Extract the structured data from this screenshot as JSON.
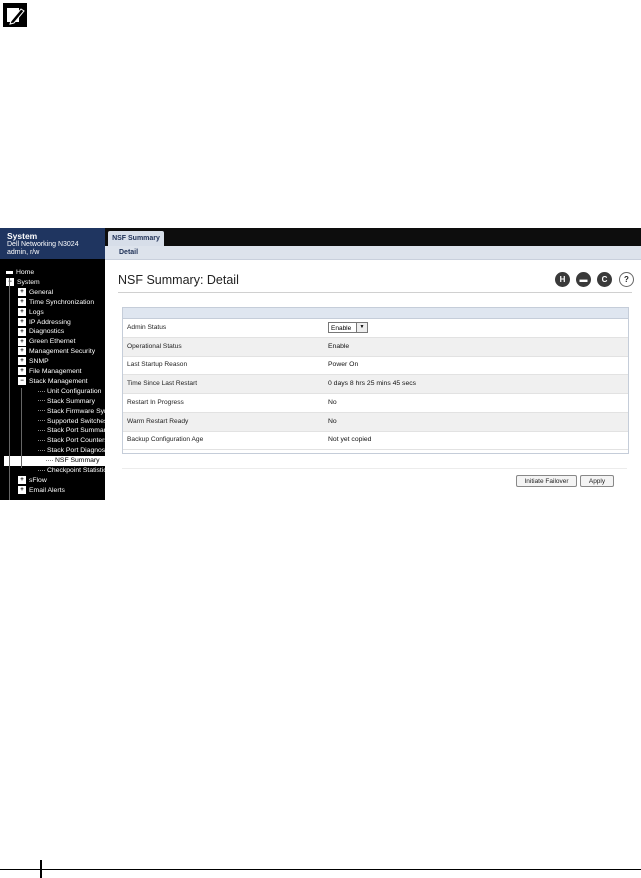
{
  "note_icon": "pencil-note-icon",
  "sidebar": {
    "title": "System",
    "device": "Dell Networking N3024",
    "user": "admin, r/w",
    "tree": [
      {
        "label": "Home",
        "level": 0,
        "box": "",
        "row": 0
      },
      {
        "label": "System",
        "level": 0,
        "box": "−",
        "row": 1
      },
      {
        "label": "General",
        "level": 1,
        "box": "+",
        "row": 2
      },
      {
        "label": "Time Synchronization",
        "level": 1,
        "box": "+",
        "row": 3
      },
      {
        "label": "Logs",
        "level": 1,
        "box": "+",
        "row": 4
      },
      {
        "label": "IP Addressing",
        "level": 1,
        "box": "+",
        "row": 5
      },
      {
        "label": "Diagnostics",
        "level": 1,
        "box": "+",
        "row": 6
      },
      {
        "label": "Green Ethernet",
        "level": 1,
        "box": "+",
        "row": 7
      },
      {
        "label": "Management Security",
        "level": 1,
        "box": "+",
        "row": 8
      },
      {
        "label": "SNMP",
        "level": 1,
        "box": "+",
        "row": 9
      },
      {
        "label": "File Management",
        "level": 1,
        "box": "+",
        "row": 10
      },
      {
        "label": "Stack Management",
        "level": 1,
        "box": "−",
        "row": 11
      },
      {
        "label": "Unit Configuration",
        "level": 2,
        "box": "",
        "row": 12
      },
      {
        "label": "Stack Summary",
        "level": 2,
        "box": "",
        "row": 13
      },
      {
        "label": "Stack Firmware Syn",
        "level": 2,
        "box": "",
        "row": 14
      },
      {
        "label": "Supported Switches",
        "level": 2,
        "box": "",
        "row": 15
      },
      {
        "label": "Stack Port Summar",
        "level": 2,
        "box": "",
        "row": 16
      },
      {
        "label": "Stack Port Counters",
        "level": 2,
        "box": "",
        "row": 17
      },
      {
        "label": "Stack Port Diagnost",
        "level": 2,
        "box": "",
        "row": 18
      },
      {
        "label": "NSF Summary",
        "level": 2,
        "box": "",
        "row": 19,
        "selected": true
      },
      {
        "label": "Checkpoint Statistic",
        "level": 2,
        "box": "",
        "row": 20
      },
      {
        "label": "sFlow",
        "level": 1,
        "box": "+",
        "row": 21
      },
      {
        "label": "Email Alerts",
        "level": 1,
        "box": "+",
        "row": 22
      }
    ]
  },
  "tabs": {
    "active": "NSF Summary",
    "sub": "Detail"
  },
  "page_title": "NSF Summary: Detail",
  "toolbar_icons": [
    "save-icon",
    "print-icon",
    "refresh-icon",
    "help-icon"
  ],
  "rows": [
    {
      "label": "Admin Status",
      "value": "Enable",
      "control": "select"
    },
    {
      "label": "Operational Status",
      "value": "Enable"
    },
    {
      "label": "Last Startup Reason",
      "value": "Power On"
    },
    {
      "label": "Time Since Last Restart",
      "value": "0 days 8 hrs 25 mins 45 secs"
    },
    {
      "label": "Restart In Progress",
      "value": "No"
    },
    {
      "label": "Warm Restart Ready",
      "value": "No"
    },
    {
      "label": "Backup Configuration Age",
      "value": "Not yet copied"
    }
  ],
  "buttons": {
    "failover": "Initiate Failover",
    "apply": "Apply"
  }
}
